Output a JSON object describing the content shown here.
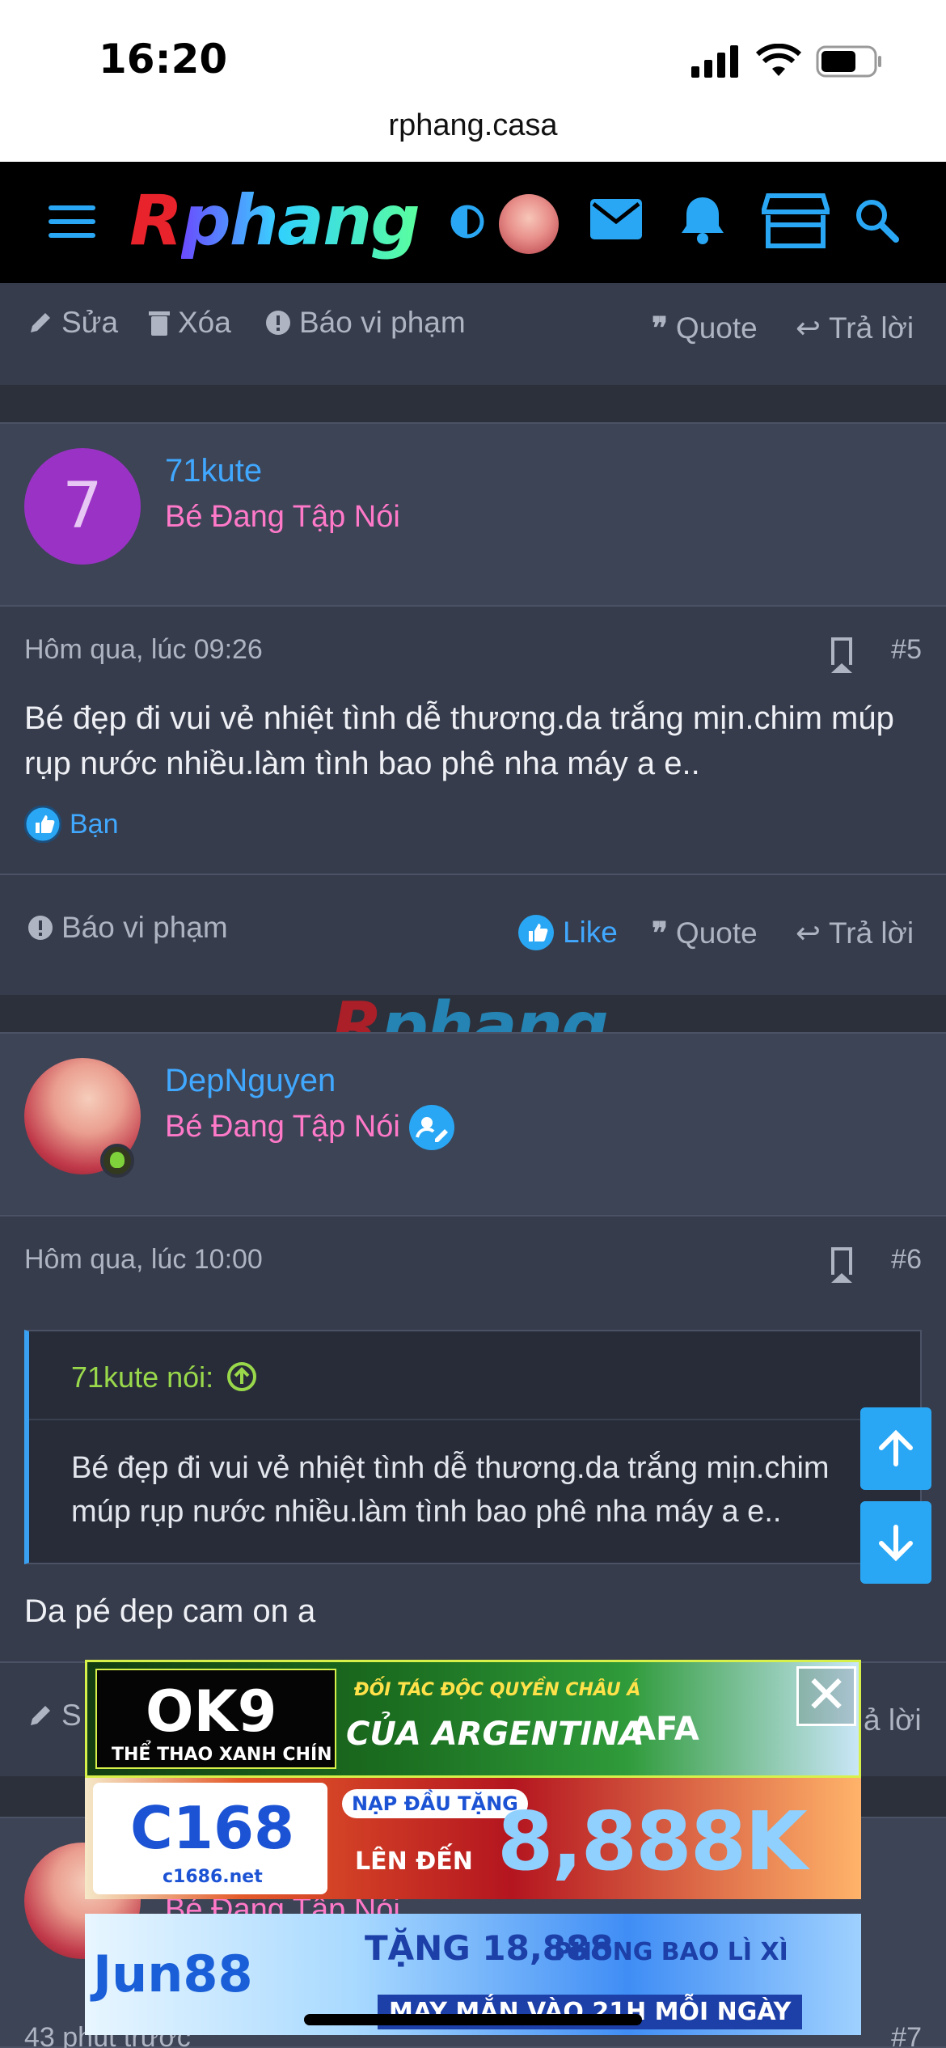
{
  "status_bar": {
    "time": "16:20",
    "url": "rphang.casa"
  },
  "nav": {
    "logo_r": "R",
    "logo_p": "ph",
    "logo_h": "ang",
    "icons": [
      "menu-icon",
      "contrast-icon",
      "mail-icon",
      "bell-icon",
      "store-icon",
      "search-icon"
    ]
  },
  "top_actions": {
    "edit": "Sửa",
    "delete": "Xóa",
    "report": "Báo vi phạm",
    "quote": "Quote",
    "reply": "Trả lời"
  },
  "posts": [
    {
      "avatar_letter": "7",
      "username": "71kute",
      "user_title": "Bé Đang Tập Nói",
      "time": "Hôm qua, lúc 09:26",
      "number": "#5",
      "message": "Bé đẹp đi vui vẻ nhiệt tình dễ thương.da trắng mịn.chim múp rụp nước nhiều.làm tình bao phê nha máy a e..",
      "reaction_label": "Bạn",
      "actions": {
        "report": "Báo vi phạm",
        "like": "Like",
        "quote": "Quote",
        "reply": "Trả lời"
      }
    },
    {
      "username": "DepNguyen",
      "user_title": "Bé Đang Tập Nói",
      "time": "Hôm qua, lúc 10:00",
      "number": "#6",
      "quote_author": "71kute nói:",
      "quote_text": "Bé đẹp đi vui vẻ nhiệt tình dễ thương.da trắng mịn.chim múp rụp nước nhiều.làm tình bao phê nha máy a e..",
      "message": "Da pé dep cam on a",
      "actions_partial": {
        "edit": "S",
        "reply": "ả lời"
      }
    }
  ],
  "watermark": {
    "r": "R",
    "rest": "phang"
  },
  "next_post": {
    "user_title": "Bé Đang Tập Nói",
    "time": "43 phút trước",
    "number": "#7"
  },
  "ads": [
    {
      "brand": "OK9",
      "tagline": "THỂ THAO XANH CHÍN",
      "headline": "ĐỐI TÁC ĐỘC QUYỀN CHÂU Á",
      "sub": "CỦA ARGENTINA",
      "badge": "AFA"
    },
    {
      "brand": "C168",
      "site": "c1686.net",
      "pill": "NẠP ĐẦU TẶNG",
      "amount": "8,888K",
      "sub": "LÊN ĐẾN"
    },
    {
      "brand": "Jun88",
      "headline": "TẶNG 18,888",
      "headline2": "PHONG BAO LÌ XÌ",
      "sub": "MAY MẮN VÀO 21H MỖI NGÀY"
    }
  ],
  "colors": {
    "accent": "#41a8ff",
    "title_pink": "#ff79c9",
    "bg": "#2c303b",
    "scroll_btn": "#2aa7f4"
  }
}
